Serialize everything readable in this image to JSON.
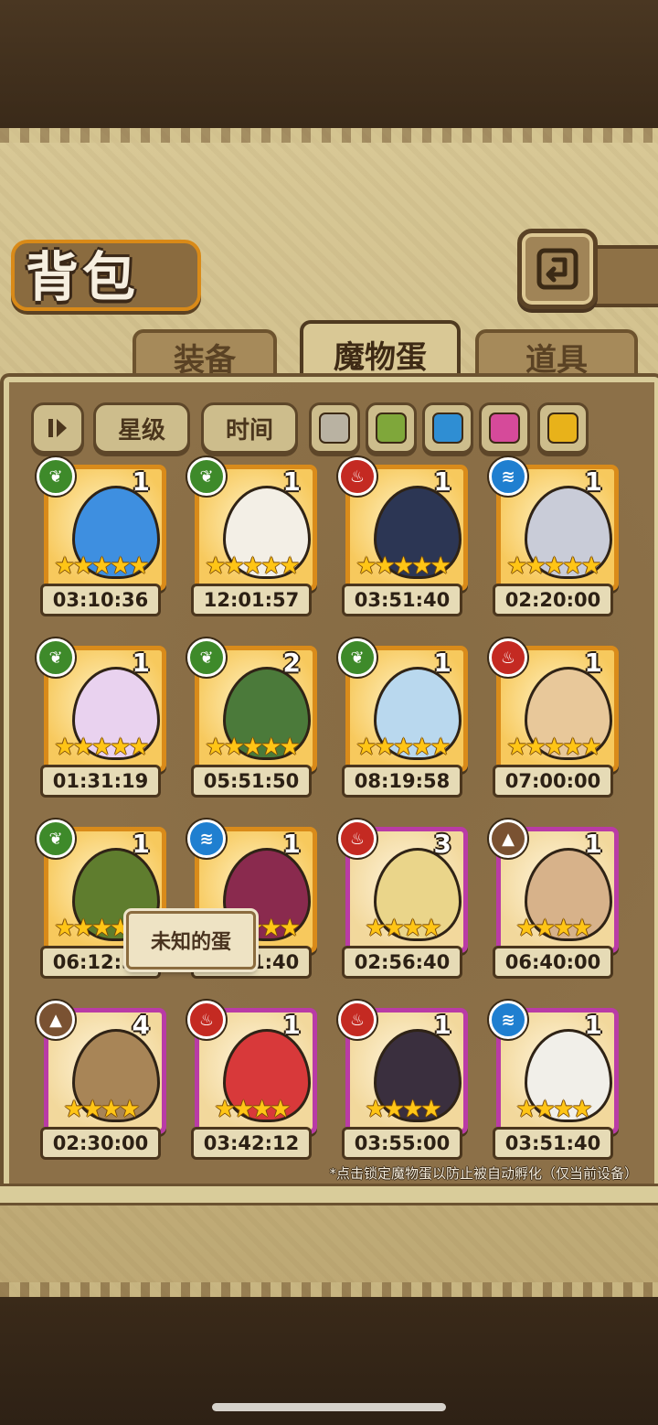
{
  "header": {
    "title": "背包"
  },
  "tabs": [
    {
      "label": "装备",
      "active": false
    },
    {
      "label": "魔物蛋",
      "active": true
    },
    {
      "label": "道具",
      "active": false
    }
  ],
  "sort": {
    "star_label": "星级",
    "time_label": "时间"
  },
  "filters": {
    "gray": "#b9b2a2",
    "green": "#7fa73a",
    "blue": "#2f8ed3",
    "pink": "#d64a9a",
    "gold": "#e8b21a"
  },
  "eggs": [
    {
      "count": "1",
      "element": "plant",
      "stars": "★★★★★",
      "timer": "03:10:36",
      "rarity": "orange"
    },
    {
      "count": "1",
      "element": "plant",
      "stars": "★★★★★",
      "timer": "12:01:57",
      "rarity": "orange"
    },
    {
      "count": "1",
      "element": "fire",
      "stars": "★★★★★",
      "timer": "03:51:40",
      "rarity": "orange"
    },
    {
      "count": "1",
      "element": "water",
      "stars": "★★★★★",
      "timer": "02:20:00",
      "rarity": "orange"
    },
    {
      "count": "1",
      "element": "plant",
      "stars": "★★★★★",
      "timer": "01:31:19",
      "rarity": "orange"
    },
    {
      "count": "2",
      "element": "plant",
      "stars": "★★★★★",
      "timer": "05:51:50",
      "rarity": "orange"
    },
    {
      "count": "1",
      "element": "plant",
      "stars": "★★★★★",
      "timer": "08:19:58",
      "rarity": "orange"
    },
    {
      "count": "1",
      "element": "fire",
      "stars": "★★★★★",
      "timer": "07:00:00",
      "rarity": "orange"
    },
    {
      "count": "1",
      "element": "plant",
      "stars": "★★★★★",
      "timer": "06:12:54",
      "rarity": "orange"
    },
    {
      "count": "1",
      "element": "water",
      "stars": "★★★★★",
      "timer": "04:21:40",
      "rarity": "orange"
    },
    {
      "count": "3",
      "element": "fire",
      "stars": "★★★★",
      "timer": "02:56:40",
      "rarity": "purple"
    },
    {
      "count": "1",
      "element": "earth",
      "stars": "★★★★",
      "timer": "06:40:00",
      "rarity": "purple"
    },
    {
      "count": "4",
      "element": "earth",
      "stars": "★★★★",
      "timer": "02:30:00",
      "rarity": "purple"
    },
    {
      "count": "1",
      "element": "fire",
      "stars": "★★★★",
      "timer": "03:42:12",
      "rarity": "purple"
    },
    {
      "count": "1",
      "element": "fire",
      "stars": "★★★★",
      "timer": "03:55:00",
      "rarity": "purple"
    },
    {
      "count": "1",
      "element": "water",
      "stars": "★★★★",
      "timer": "03:51:40",
      "rarity": "purple"
    }
  ],
  "tooltip": {
    "text": "未知的蛋"
  },
  "footer": {
    "note": "*点击锁定魔物蛋以防止被自动孵化（仅当前设备）"
  }
}
